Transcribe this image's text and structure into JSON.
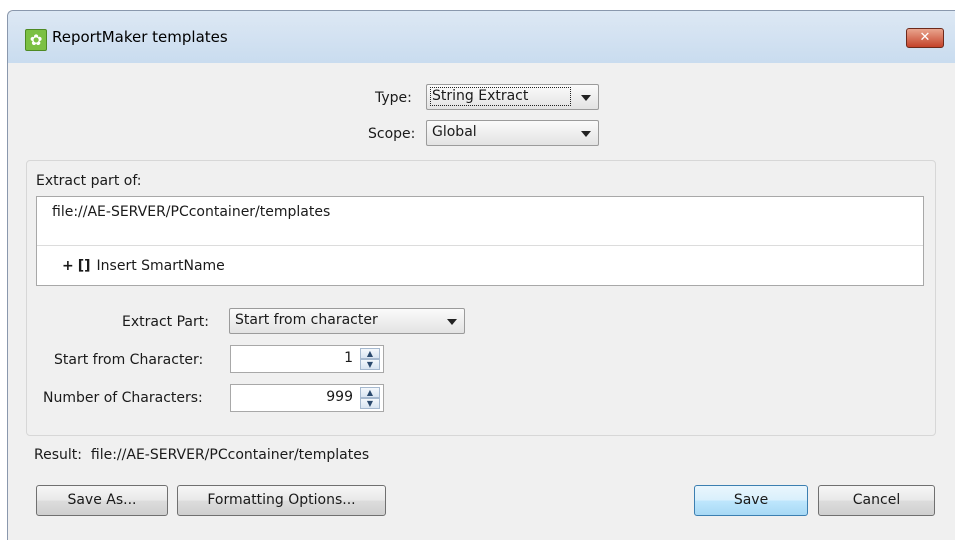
{
  "window": {
    "title": "ReportMaker templates",
    "close_label": "✕"
  },
  "type": {
    "label": "Type:",
    "value": "String Extract"
  },
  "scope": {
    "label": "Scope:",
    "value": "Global"
  },
  "extract": {
    "group_label": "Extract part of:",
    "path": "file://AE-SERVER/PCcontainer/templates",
    "insert_plus": "+",
    "insert_brackets": "[]",
    "insert_label": "Insert SmartName"
  },
  "extract_part": {
    "label": "Extract Part:",
    "value": "Start from character"
  },
  "start_char": {
    "label": "Start from Character:",
    "value": "1"
  },
  "num_chars": {
    "label": "Number of Characters:",
    "value": "999"
  },
  "result": {
    "label": "Result:",
    "value": "file://AE-SERVER/PCcontainer/templates"
  },
  "buttons": {
    "save_as": "Save As...",
    "formatting": "Formatting Options...",
    "save": "Save",
    "cancel": "Cancel"
  },
  "colors": {
    "app_icon": "#7bc043",
    "close_button": "#c4432a",
    "primary_button": "#bee6fd"
  },
  "icons": {
    "app": "gear-icon",
    "close": "close-icon",
    "dropdown": "chevron-down-icon",
    "spinner": "spinner-arrows-icon"
  }
}
